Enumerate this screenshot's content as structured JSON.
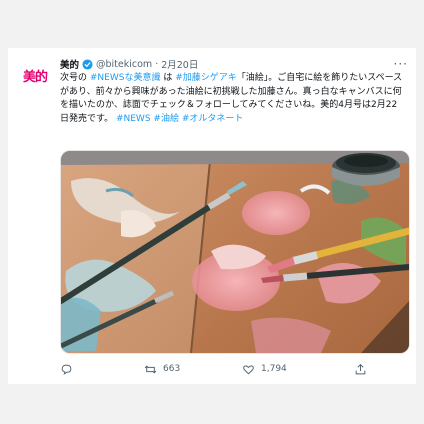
{
  "tweet": {
    "avatar_text": "美的",
    "display_name": "美的",
    "handle": "@bitekicom",
    "date": "2月20日",
    "more_label": "···",
    "text_parts": [
      {
        "text": "次号の ",
        "type": "text"
      },
      {
        "text": "#NEWSな美意識",
        "type": "hashtag"
      },
      {
        "text": " は ",
        "type": "text"
      },
      {
        "text": "#加藤シゲアキ",
        "type": "hashtag"
      },
      {
        "text": "「油絵」。ご自宅に絵を飾りたいスペースがあり、前々から興味があった油絵に初挑戦した加藤さん。真っ白なキャンバスに何を描いたのか、誌面でチェック＆フォローしてみてくださいね。美的4月号は2月22日発売です。 ",
        "type": "text"
      },
      {
        "text": "#NEWS",
        "type": "hashtag"
      },
      {
        "text": " ",
        "type": "text"
      },
      {
        "text": "#油絵",
        "type": "hashtag"
      },
      {
        "text": " ",
        "type": "text"
      },
      {
        "text": "#オルタネート",
        "type": "hashtag"
      }
    ],
    "actions": {
      "retweet_count": "663",
      "like_count": "1,794"
    }
  },
  "colors": {
    "brand": "#e4006f",
    "link": "#1d9bf0",
    "muted": "#536471",
    "verified": "#1d9bf0"
  },
  "icons": [
    "verified-badge-icon",
    "more-icon",
    "reply-icon",
    "retweet-icon",
    "like-icon",
    "share-icon"
  ]
}
